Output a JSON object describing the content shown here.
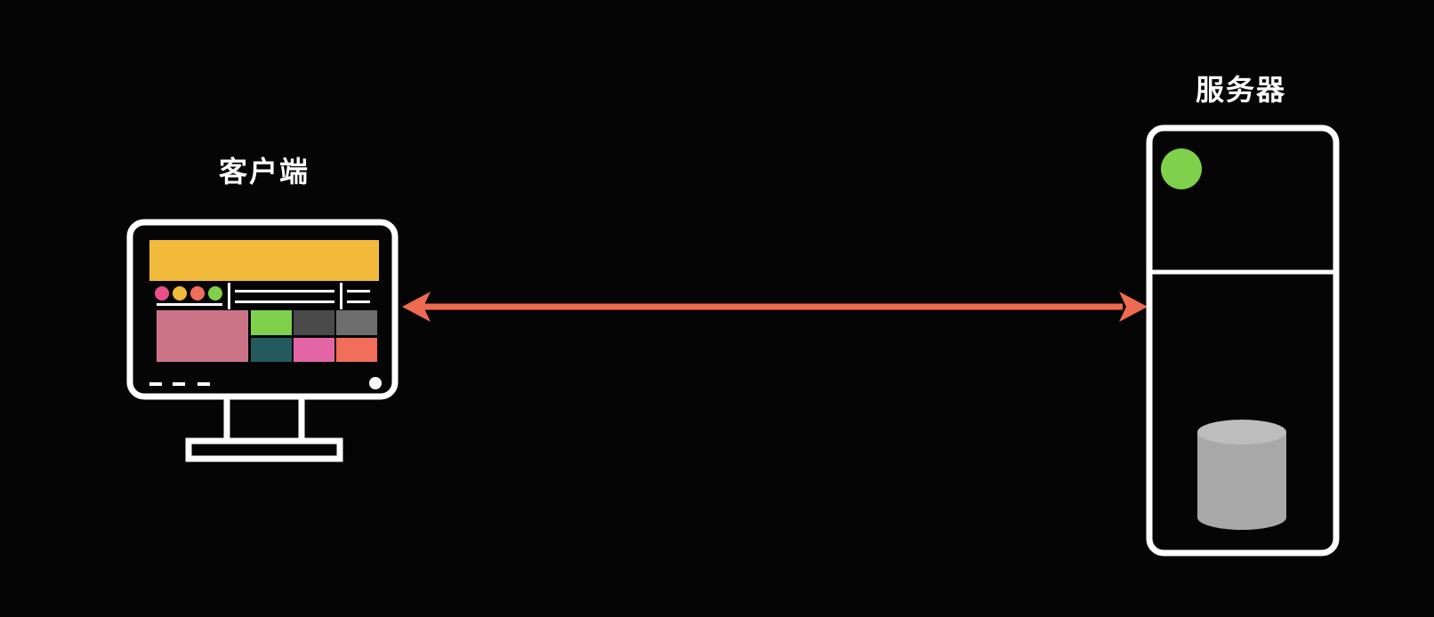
{
  "client": {
    "label": "客户端"
  },
  "server": {
    "label": "服务器"
  },
  "colors": {
    "background": "#050505",
    "outline": "#ffffff",
    "arrow": "#ee6a50",
    "header_bar": "#f1ba3a",
    "dot_pink": "#ea4f8c",
    "dot_yellow": "#f1ba3a",
    "dot_orange": "#f06e5a",
    "dot_green": "#7fd04a",
    "tile_large_pink": "#cb7488",
    "tile_green": "#7fd04a",
    "tile_dark_gray": "#4a4a4a",
    "tile_gray": "#6e6e6e",
    "tile_teal": "#245a5e",
    "tile_magenta": "#e465a5",
    "tile_coral": "#f06e5a",
    "server_status_light": "#7fd04a",
    "database": "#a8a8a8"
  },
  "icons": {
    "client": "desktop-monitor-icon",
    "server": "server-rack-icon",
    "database": "database-cylinder-icon",
    "link": "bidirectional-arrow"
  }
}
